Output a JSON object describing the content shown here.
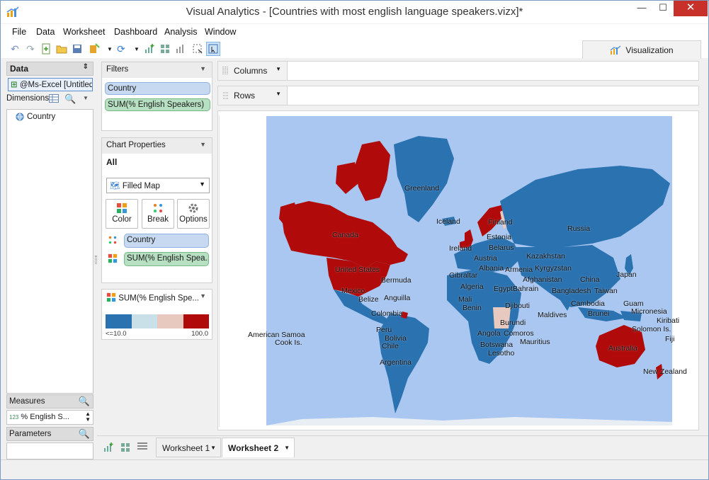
{
  "window": {
    "title": "Visual Analytics - [Countries with most english language speakers.vizx]*",
    "minimize": "—",
    "maximize": "☐",
    "close": "✕"
  },
  "menu": [
    "File",
    "Data",
    "Worksheet",
    "Dashboard",
    "Analysis",
    "Window"
  ],
  "toolbar": {
    "viz_tab_label": "Visualization"
  },
  "data_panel": {
    "header": "Data",
    "datasource": "@Ms-Excel [Untitled]",
    "dimensions_label": "Dimensions",
    "dimensions": [
      "Country"
    ],
    "measures_label": "Measures",
    "measures": [
      "% English S..."
    ],
    "measure_prefix": "123",
    "parameters_label": "Parameters"
  },
  "filters": {
    "header": "Filters",
    "items": [
      {
        "label": "Country",
        "kind": "dimension"
      },
      {
        "label": "SUM(% English Speakers)",
        "kind": "measure"
      }
    ]
  },
  "chart_properties": {
    "header": "Chart Properties",
    "scope": "All",
    "chart_type": "Filled Map",
    "buttons": [
      "Color",
      "Break",
      "Options"
    ],
    "marks": [
      {
        "label": "Country",
        "kind": "dimension"
      },
      {
        "label": "SUM(% English Spea...",
        "kind": "measure"
      }
    ]
  },
  "legend": {
    "header": "SUM(% English Spe...",
    "min_label": "<=10.0",
    "max_label": "100.0",
    "colors": [
      "#2b72b0",
      "#c9e0e8",
      "#e8c9c0",
      "#b00a0a"
    ]
  },
  "shelves": {
    "columns": "Columns",
    "rows": "Rows"
  },
  "map": {
    "ocean_color": "#a9c7f1",
    "high_color": "#b00a0a",
    "low_color": "#2b72b0",
    "labels": [
      "Greenland",
      "Iceland",
      "Finland",
      "Russia",
      "Canada",
      "Estonia",
      "Ireland",
      "Belarus",
      "Kazakhstan",
      "Austria",
      "Albania",
      "Armenia",
      "Kyrgyzstan",
      "United States",
      "Gibraltar",
      "Afghanistan",
      "China",
      "Japan",
      "Bermuda",
      "Algeria",
      "Egypt",
      "Bahrain",
      "Bangladesh",
      "Taiwan",
      "Mexico",
      "Anguilla",
      "Belize",
      "Mali",
      "Djibouti",
      "Cambodia",
      "Guam",
      "Micronesia",
      "Colombia",
      "Benin",
      "Brunei",
      "Maldives",
      "Burundi",
      "Kiribati",
      "Peru",
      "Angola",
      "Comoros",
      "Solomon Is.",
      "American Samoa",
      "Bolivia",
      "Fiji",
      "Cook Is.",
      "Chile",
      "Mauritius",
      "Botswana",
      "Australia",
      "Lesotho",
      "Argentina",
      "New Zealand"
    ]
  },
  "worksheets": {
    "tabs": [
      "Worksheet 1",
      "Worksheet 2"
    ],
    "active": "Worksheet 2"
  }
}
